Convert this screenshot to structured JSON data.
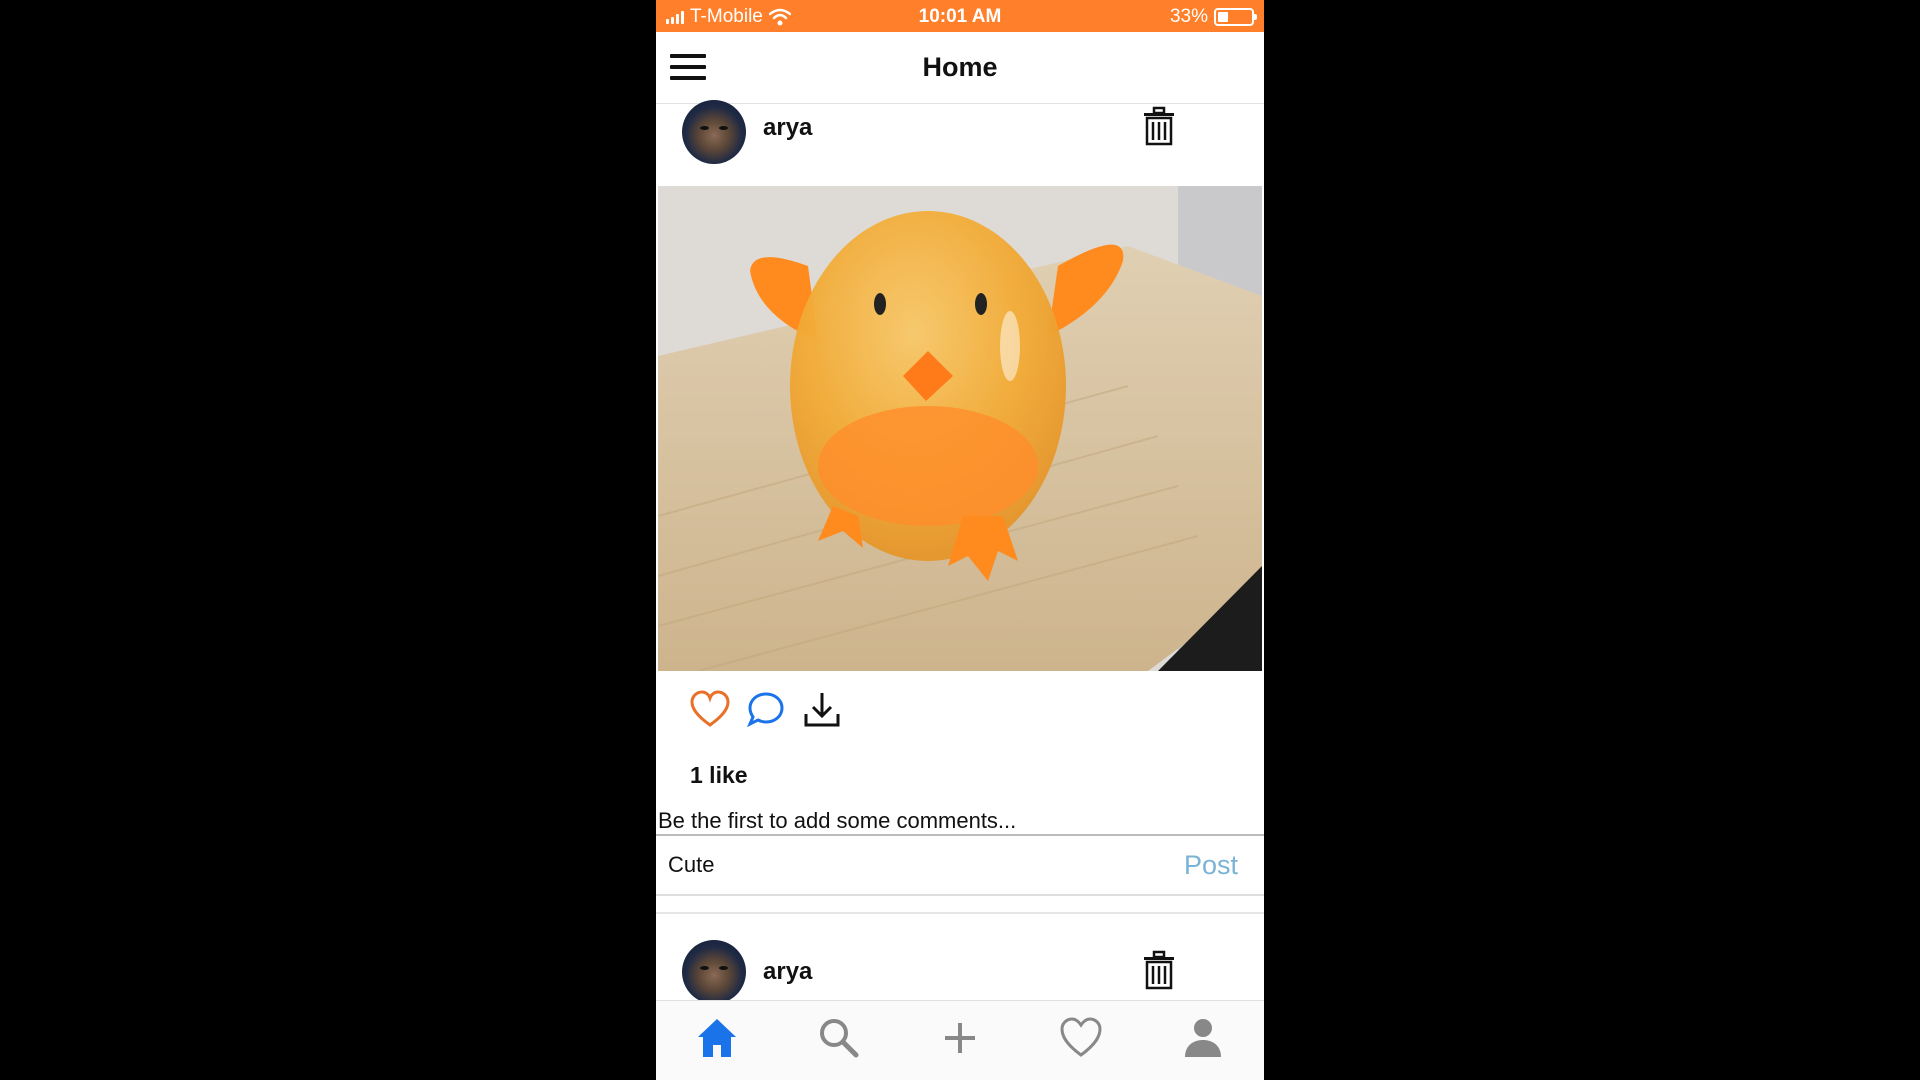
{
  "status_bar": {
    "carrier": "T-Mobile",
    "time": "10:01 AM",
    "battery_percent": "33%",
    "battery_level": 0.33,
    "color": "#ff7f2a"
  },
  "header": {
    "title": "Home",
    "menu_icon": "hamburger-menu-icon"
  },
  "posts": [
    {
      "username": "arya",
      "delete_icon": "trash-icon",
      "image": "photo of orange toy chick egg on wooden surface",
      "actions": [
        "heart-icon",
        "comment-icon",
        "download-icon"
      ],
      "likes": "1 like",
      "comments_hint": "Be the first to add some comments...",
      "comment_input_value": "Cute",
      "post_label": "Post"
    },
    {
      "username": "arya",
      "delete_icon": "trash-icon"
    }
  ],
  "tab_bar": {
    "items": [
      "home-icon",
      "search-icon",
      "add-icon",
      "heart-icon",
      "profile-icon"
    ],
    "active": "home-icon",
    "active_color": "#1a73e8",
    "inactive_color": "#888888"
  }
}
